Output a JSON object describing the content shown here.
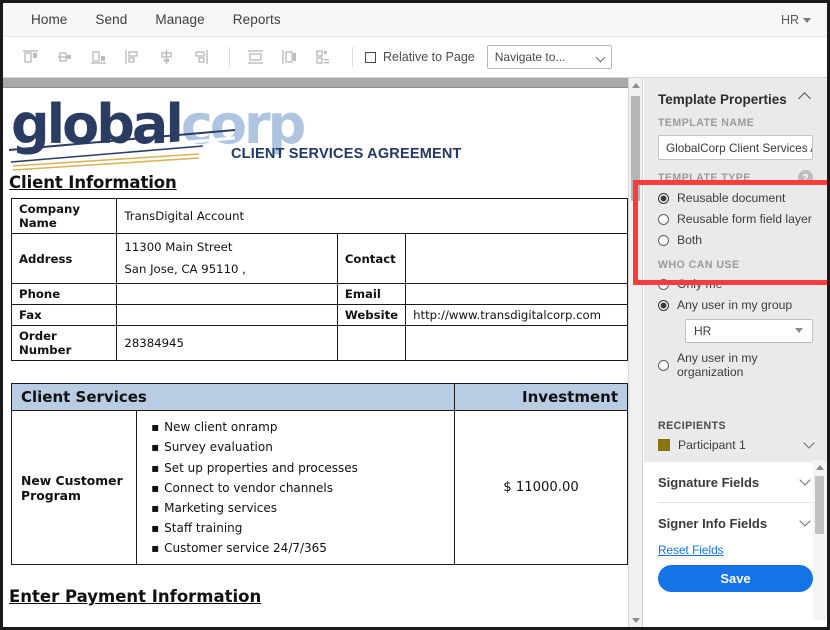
{
  "window": {
    "accent_blue": "#1473e6",
    "highlight_red": "#fa3c3c"
  },
  "topnav": {
    "items": [
      {
        "label": "Home"
      },
      {
        "label": "Send"
      },
      {
        "label": "Manage"
      },
      {
        "label": "Reports"
      }
    ],
    "account": {
      "label": "HR",
      "caret_icon": "caret-down-icon"
    }
  },
  "toolbar": {
    "tools": [
      {
        "name": "align-top-icon"
      },
      {
        "name": "align-center-horizontal-icon"
      },
      {
        "name": "align-bottom-icon"
      },
      {
        "name": "align-left-icon"
      },
      {
        "name": "align-center-vertical-icon"
      },
      {
        "name": "align-right-icon"
      },
      {
        "name": "distribute-vertical-icon"
      },
      {
        "name": "distribute-horizontal-icon"
      },
      {
        "name": "match-size-icon"
      }
    ],
    "relative_to_page": {
      "label": "Relative to Page",
      "checked": false
    },
    "navigate_select": {
      "value": "Navigate to...",
      "chevron_icon": "chevron-down-icon"
    }
  },
  "document": {
    "logo": {
      "part1": "global",
      "part2": "corp"
    },
    "title": "CLIENT SERVICES AGREEMENT",
    "section1_heading": "Client Information",
    "client_info": [
      {
        "label": "Company Name",
        "value": "TransDigital Account",
        "label2": "",
        "value2": ""
      },
      {
        "label": "Address",
        "value_line1": "11300 Main Street",
        "value_line2": "San Jose, CA  95110  ,",
        "label2": "Contact",
        "value2": ""
      },
      {
        "label": "Phone",
        "value": "",
        "label2": "Email",
        "value2": ""
      },
      {
        "label": "Fax",
        "value": "",
        "label2": "Website",
        "value2": "http://www.transdigitalcorp.com"
      },
      {
        "label": "Order Number",
        "value": "28384945",
        "label2": "",
        "value2": ""
      }
    ],
    "services_table": {
      "col1_header": "Client Services",
      "col2_header": "Investment",
      "program": "New Customer Program",
      "items": [
        "New client onramp",
        "Survey evaluation",
        "Set up properties and processes",
        "Connect to vendor channels",
        "Marketing services",
        "Staff training",
        "Customer service 24/7/365"
      ],
      "amount": "$ 11000.00",
      "header_bg": "#b8cce4"
    },
    "section2_heading": "Enter Payment Information"
  },
  "panel": {
    "header": {
      "title": "Template Properties",
      "collapse_icon": "chevron-up-icon"
    },
    "template_name": {
      "section_label": "TEMPLATE NAME",
      "value": "GlobalCorp Client Services Ag"
    },
    "template_type": {
      "section_label": "TEMPLATE TYPE",
      "help_icon": "question-mark-icon",
      "help_glyph": "?",
      "options": [
        {
          "label": "Reusable document",
          "selected": true
        },
        {
          "label": "Reusable form field layer",
          "selected": false
        },
        {
          "label": "Both",
          "selected": false
        }
      ]
    },
    "who_can_use": {
      "section_label": "WHO CAN USE",
      "options": [
        {
          "label": "Only me",
          "selected": false
        },
        {
          "label": "Any user in my group",
          "selected": true
        },
        {
          "label": "Any user in my organization",
          "selected": false
        }
      ],
      "group_select": {
        "value": "HR",
        "chevron_icon": "chevron-down-icon"
      }
    },
    "recipients": {
      "section_label": "RECIPIENTS",
      "participant": {
        "label": "Participant 1",
        "color": "#8a7410",
        "chevron_icon": "chevron-down-icon"
      }
    },
    "accordions": [
      {
        "label": "Signature Fields",
        "chevron_icon": "chevron-down-icon"
      },
      {
        "label": "Signer Info Fields",
        "chevron_icon": "chevron-down-icon"
      }
    ],
    "reset_link": "Reset Fields",
    "save_button": "Save"
  }
}
